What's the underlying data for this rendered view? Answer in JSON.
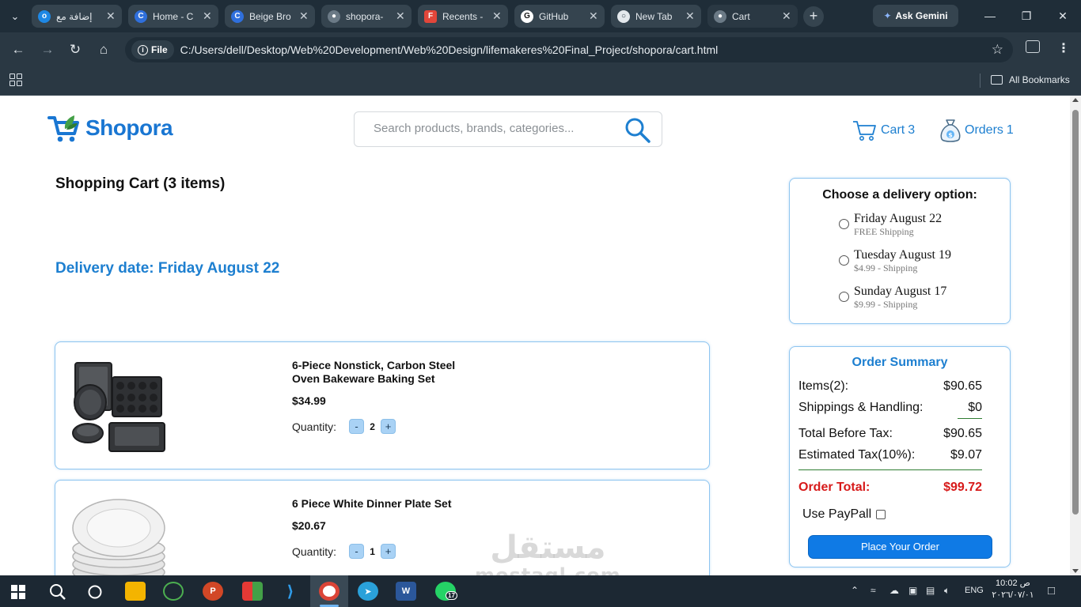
{
  "browser": {
    "tabs": [
      {
        "label": "إضافة مع",
        "favicon": "blue-circle-icon",
        "color": "#1e88e5"
      },
      {
        "label": "Home - C",
        "favicon": "canva-icon",
        "color": "#2f6fdc"
      },
      {
        "label": "Beige Bro",
        "favicon": "canva-icon",
        "color": "#2f6fdc"
      },
      {
        "label": "shopora-",
        "favicon": "globe-icon",
        "color": "#6b7a86"
      },
      {
        "label": "Recents -",
        "favicon": "figma-icon",
        "color": "#e2463a"
      },
      {
        "label": "GitHub",
        "favicon": "github-icon",
        "color": "#111111"
      },
      {
        "label": "New Tab",
        "favicon": "chrome-icon",
        "color": "#e3e8ec"
      },
      {
        "label": "Cart",
        "favicon": "globe-icon",
        "color": "#6b7a86"
      }
    ],
    "gemini_label": "Ask Gemini",
    "file_chip": "File",
    "url": "C:/Users/dell/Desktop/Web%20Development/Web%20Design/lifemakeres%20Final_Project/shopora/cart.html",
    "bookmarks_label": "All Bookmarks"
  },
  "page": {
    "logo_text": "Shopora",
    "search_placeholder": "Search products, brands, categories...",
    "cart_label": "Cart",
    "cart_count": "3",
    "orders_label": "Orders",
    "orders_count": "1",
    "heading": "Shopping Cart (3 items)",
    "delivery_date": "Delivery date: Friday August 22",
    "items": [
      {
        "name": "6-Piece Nonstick, Carbon Steel Oven Bakeware Baking Set",
        "price": "$34.99",
        "qty_label": "Quantity:",
        "qty": "2",
        "image": "bakeware-image"
      },
      {
        "name": "6 Piece White Dinner Plate Set",
        "price": "$20.67",
        "qty_label": "Quantity:",
        "qty": "1",
        "image": "dinner-plates-image"
      }
    ],
    "delivery": {
      "title": "Choose a delivery option:",
      "options": [
        {
          "date": "Friday August 22",
          "shipping": "FREE Shipping"
        },
        {
          "date": "Tuesday August 19",
          "shipping": "$4.99 - Shipping"
        },
        {
          "date": "Sunday August 17",
          "shipping": "$9.99 - Shipping"
        }
      ]
    },
    "summary": {
      "title": "Order Summary",
      "rows": [
        {
          "label": "Items(2):",
          "value": "$90.65"
        },
        {
          "label": "Shippings & Handling:",
          "value": "$0"
        },
        {
          "label": "Total Before Tax:",
          "value": "$90.65"
        },
        {
          "label": "Estimated Tax(10%):",
          "value": "$9.07"
        }
      ],
      "total_label": "Order Total:",
      "total_value": "$99.72",
      "paypal_label": "Use PayPall",
      "place_order": "Place Your Order"
    },
    "watermark_ar": "مستقل",
    "watermark_en": "mostaql.com"
  },
  "taskbar": {
    "lang": "ENG",
    "time": "10:02 ص",
    "date": "٢٠٢٦/٠٧/٠١",
    "whatsapp_badge": "17"
  },
  "colors": {
    "brand_blue": "#1976d2",
    "link_blue": "#1d7fd0",
    "total_red": "#d71a1a",
    "panel_border": "#8ec5f0",
    "button_blue": "#0f7ae5"
  }
}
